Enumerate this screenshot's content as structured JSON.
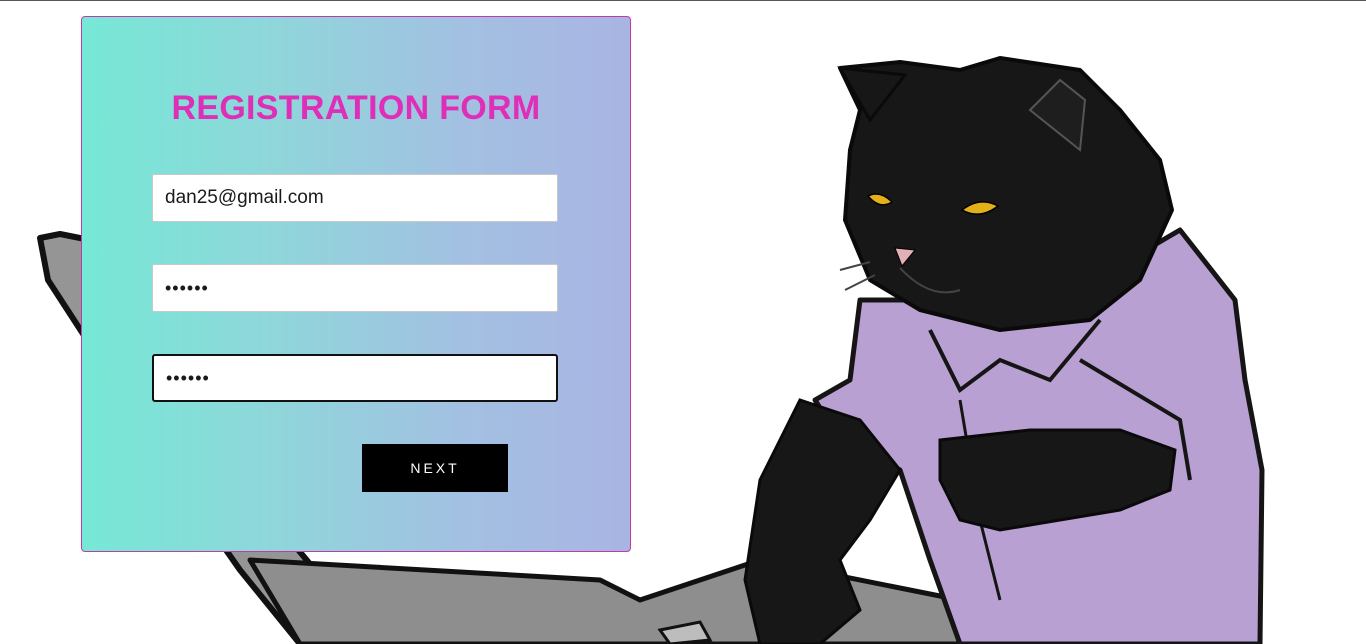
{
  "form": {
    "title": "REGISTRATION FORM",
    "email_value": "dan25@gmail.com",
    "password_value": "123456",
    "confirm_password_value": "123456",
    "next_label": "NEXT"
  },
  "colors": {
    "title": "#df2fb8",
    "card_border": "#c23aa8",
    "gradient_start": "#76e8d6",
    "gradient_end": "#a9b4e3",
    "button_bg": "#000000",
    "cat_shirt": "#b9a0d2",
    "laptop": "#959595"
  },
  "illustration": {
    "subject": "black-cat-typing-on-laptop"
  }
}
